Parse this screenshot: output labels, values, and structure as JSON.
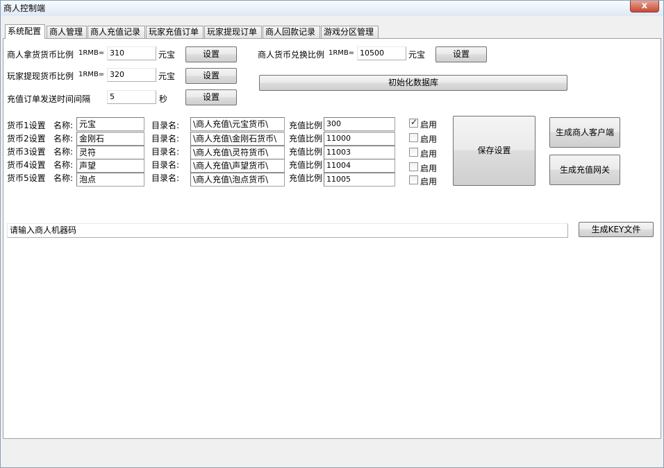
{
  "window": {
    "title": "商人控制端",
    "close_glyph": "x"
  },
  "tabs": [
    {
      "label": "系统配置"
    },
    {
      "label": "商人管理"
    },
    {
      "label": "商人充值记录"
    },
    {
      "label": "玩家充值订单"
    },
    {
      "label": "玩家提现订单"
    },
    {
      "label": "商人回款记录"
    },
    {
      "label": "游戏分区管理"
    }
  ],
  "config": {
    "merchant_ratio": {
      "label": "商人拿货货币比例",
      "prefix": "1RMB=",
      "value": "310",
      "unit": "元宝",
      "button": "设置"
    },
    "withdraw_ratio": {
      "label": "玩家提现货币比例",
      "prefix": "1RMB=",
      "value": "320",
      "unit": "元宝",
      "button": "设置"
    },
    "interval": {
      "label": "充值订单发送时间间隔",
      "value": "5",
      "unit": "秒",
      "button": "设置"
    },
    "exchange_ratio": {
      "label": "商人货币兑换比例",
      "prefix": "1RMB=",
      "value": "10500",
      "unit": "元宝",
      "button": "设置"
    },
    "init_db_button": "初始化数据库"
  },
  "currency": {
    "name_label": "名称:",
    "dir_label": "目录名:",
    "ratio_label": "充值比例",
    "enable_label": "启用",
    "rows": [
      {
        "title": "货币1设置",
        "name": "元宝",
        "dir": "\\商人充值\\元宝货币\\",
        "ratio": "300",
        "enabled": true
      },
      {
        "title": "货币2设置",
        "name": "金刚石",
        "dir": "\\商人充值\\金刚石货币\\",
        "ratio": "11000",
        "enabled": false
      },
      {
        "title": "货币3设置",
        "name": "灵符",
        "dir": "\\商人充值\\灵符货币\\",
        "ratio": "11003",
        "enabled": false
      },
      {
        "title": "货币4设置",
        "name": "声望",
        "dir": "\\商人充值\\声望货币\\",
        "ratio": "11004",
        "enabled": false
      },
      {
        "title": "货币5设置",
        "name": "泡点",
        "dir": "\\商人充值\\泡点货币\\",
        "ratio": "11005",
        "enabled": false
      }
    ]
  },
  "actions": {
    "save": "保存设置",
    "gen_client": "生成商人客户端",
    "gen_gateway": "生成充值网关",
    "gen_key": "生成KEY文件"
  },
  "machine_code": {
    "value": "请输入商人机器码"
  },
  "check_glyph": "✓"
}
